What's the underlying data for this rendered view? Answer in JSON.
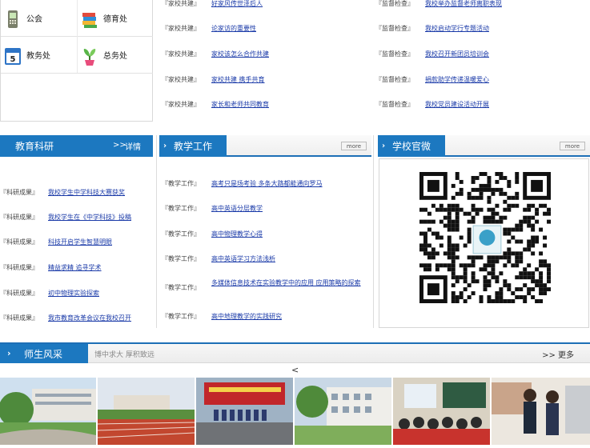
{
  "quick_links": [
    {
      "label": "公会",
      "icon": "phone-icon"
    },
    {
      "label": "德育处",
      "icon": "books-icon"
    },
    {
      "label": "教务处",
      "icon": "calendar-icon"
    },
    {
      "label": "总务处",
      "icon": "plant-icon"
    }
  ],
  "home_school": {
    "category": "『家校共建』",
    "items": [
      "好家风传世泽后人",
      "论家访的重要性",
      "家校该怎么合作共建",
      "家校共建 携手共育",
      "家长和老师共同教育"
    ]
  },
  "supervision": {
    "category": "『监督检查』",
    "items": [
      "我校举办监督老师离职表现",
      "我校启动学行专题活动",
      "我校召开新团员培训会",
      "捐款助学传递温暖爱心",
      "我校党员建设活动开展"
    ]
  },
  "research": {
    "title": "教育科研",
    "more": "详情",
    "category": "『科研成果』",
    "items": [
      "我校学生中学科技大赛获奖",
      "我校学生在《中学科技》投稿",
      "科技开启学生智慧明眼",
      "精益求精 追寻学术",
      "初中物理实验探索",
      "我市教育改革会议在我校召开"
    ]
  },
  "teaching": {
    "title": "教学工作",
    "more": "more",
    "category": "『教学工作』",
    "items": [
      "高考只是场考验 多条大路都能通向罗马",
      "高中英语分层教学",
      "高中物理教学心得",
      "高中英语学习方法浅析",
      "多媒体信息技术在实验教学中的应用 应用策略的探索",
      "高中地理教学的实践研究"
    ]
  },
  "wechat": {
    "title": "学校官微",
    "more": "more"
  },
  "showcase": {
    "title": "师生风采",
    "motto": "博中求大  厚积致远",
    "more": "更多"
  },
  "carousel": {
    "prev": "<"
  },
  "colors": {
    "accent": "#1c78c0",
    "link": "#1a3aa8"
  }
}
